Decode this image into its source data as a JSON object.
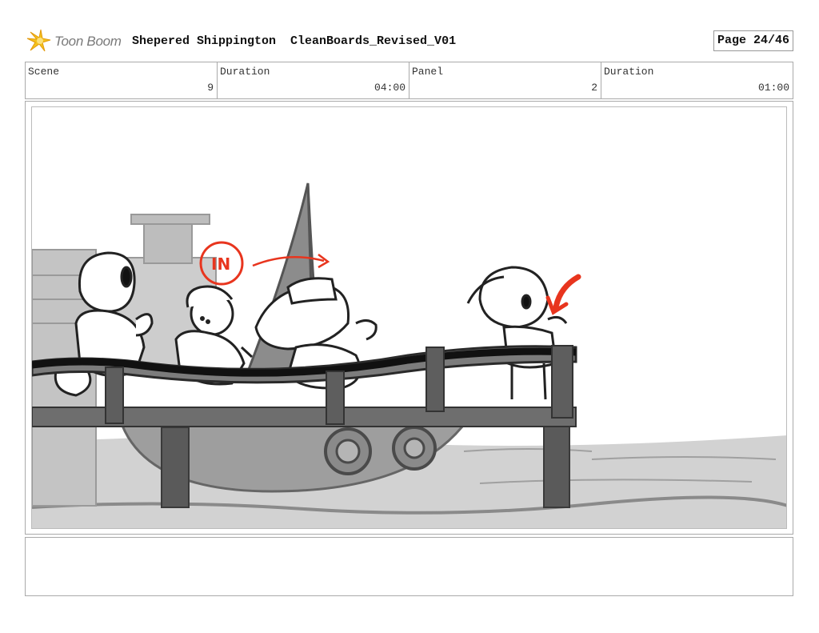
{
  "header": {
    "logo_text": "Toon Boom",
    "project_title": "Shepered Shippington  CleanBoards_Revised_V01",
    "page": "Page 24/46"
  },
  "info": {
    "scene_label": "Scene",
    "scene_value": "9",
    "scene_duration_label": "Duration",
    "scene_duration_value": "04:00",
    "panel_label": "Panel",
    "panel_value": "2",
    "panel_duration_label": "Duration",
    "panel_duration_value": "01:00"
  },
  "panel": {
    "annotation_text": "IN",
    "accent_color": "#e8351e"
  },
  "notes": {
    "text": ""
  }
}
